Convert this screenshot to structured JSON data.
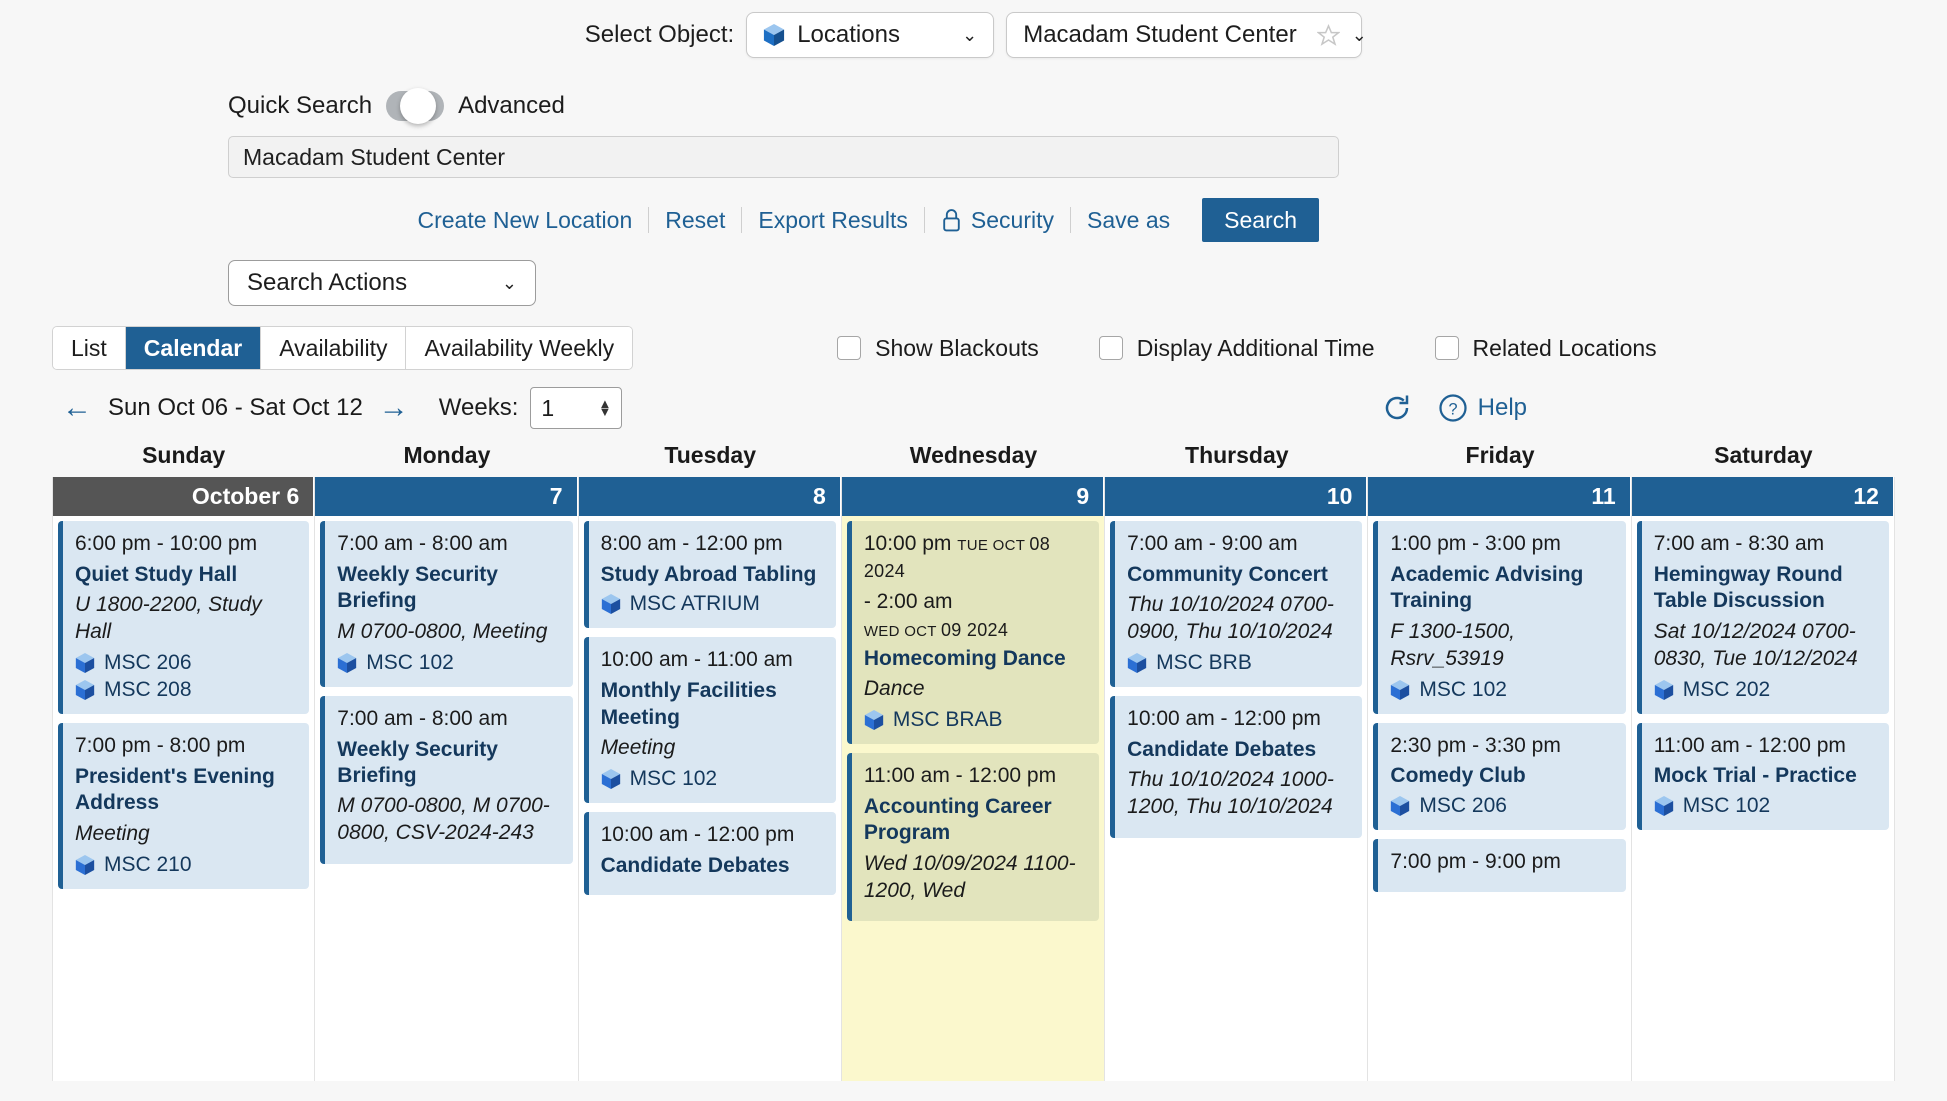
{
  "select_object": {
    "label": "Select Object:",
    "object_value": "Locations",
    "object_icon": "cube-icon",
    "location_value": "Macadam Student Center",
    "favorite_icon": "star-icon",
    "chevron": "⌄"
  },
  "quick_search": {
    "left_label": "Quick Search",
    "right_label": "Advanced",
    "input_value": "Macadam Student Center",
    "toggle_state": "middle"
  },
  "actions": {
    "create": "Create New Location",
    "reset": "Reset",
    "export": "Export Results",
    "security": "Security",
    "security_icon": "lock-icon",
    "save_as": "Save as",
    "search": "Search",
    "search_actions": "Search Actions"
  },
  "tabs": [
    {
      "label": "List",
      "active": false
    },
    {
      "label": "Calendar",
      "active": true
    },
    {
      "label": "Availability",
      "active": false
    },
    {
      "label": "Availability Weekly",
      "active": false
    }
  ],
  "checkboxes": [
    {
      "label": "Show Blackouts",
      "checked": false
    },
    {
      "label": "Display Additional Time",
      "checked": false
    },
    {
      "label": "Related Locations",
      "checked": false
    }
  ],
  "nav": {
    "prev_icon": "arrow-left-icon",
    "next_icon": "arrow-right-icon",
    "range": "Sun Oct 06 - Sat Oct 12",
    "weeks_label": "Weeks:",
    "weeks_value": "1",
    "refresh_icon": "refresh-icon",
    "help_icon": "help-icon",
    "help_label": "Help"
  },
  "colors": {
    "accent": "#1f6094",
    "today_header": "#555555",
    "event_bg": "#dae7f2",
    "event_bg_highlight": "#e2e4bd",
    "day_highlight_bg": "#fbf8cd",
    "title": "#14385c",
    "link": "#1f6094"
  },
  "calendar": {
    "days": [
      {
        "dow": "Sunday",
        "num": "October 6",
        "today": true,
        "highlight": false,
        "events": [
          {
            "time": "6:00 pm - 10:00 pm",
            "title": "Quiet Study Hall",
            "sub": "U 1800-2200, Study Hall",
            "rooms": [
              "MSC 206",
              "MSC 208"
            ]
          },
          {
            "time": "7:00 pm - 8:00 pm",
            "title": "President's Evening Address",
            "sub": "Meeting",
            "rooms": [
              "MSC 210"
            ]
          }
        ]
      },
      {
        "dow": "Monday",
        "num": "7",
        "today": false,
        "highlight": false,
        "events": [
          {
            "time": "7:00 am - 8:00 am",
            "title": "Weekly Security Briefing",
            "sub": "M 0700-0800, Meeting",
            "rooms": [
              "MSC 102"
            ]
          },
          {
            "time": "7:00 am - 8:00 am",
            "title": "Weekly Security Briefing",
            "sub": "M 0700-0800, M 0700-0800, CSV-2024-243",
            "rooms": []
          }
        ]
      },
      {
        "dow": "Tuesday",
        "num": "8",
        "today": false,
        "highlight": false,
        "events": [
          {
            "time": "8:00 am - 12:00 pm",
            "title": "Study Abroad Tabling",
            "sub": "",
            "rooms": [
              "MSC ATRIUM"
            ]
          },
          {
            "time": "10:00 am - 11:00 am",
            "title": "Monthly Facilities Meeting",
            "sub": "Meeting",
            "rooms": [
              "MSC 102"
            ]
          },
          {
            "time": "10:00 am - 12:00 pm",
            "title": "Candidate Debates",
            "sub": "",
            "rooms": []
          }
        ]
      },
      {
        "dow": "Wednesday",
        "num": "9",
        "today": false,
        "highlight": true,
        "events": [
          {
            "time": "10:00 pm",
            "time_stamp": "TUE OCT 08 2024",
            "time2": "- 2:00 am",
            "time2_stamp": "WED OCT 09 2024",
            "title": "Homecoming Dance",
            "sub": "Dance",
            "rooms": [
              "MSC BRAB"
            ]
          },
          {
            "time": "11:00 am - 12:00 pm",
            "title": "Accounting Career Program",
            "sub": "Wed 10/09/2024 1100-1200, Wed",
            "rooms": []
          }
        ]
      },
      {
        "dow": "Thursday",
        "num": "10",
        "today": false,
        "highlight": false,
        "events": [
          {
            "time": "7:00 am - 9:00 am",
            "title": "Community Concert",
            "sub": "Thu 10/10/2024 0700-0900, Thu 10/10/2024",
            "rooms": [
              "MSC BRB"
            ]
          },
          {
            "time": "10:00 am - 12:00 pm",
            "title": "Candidate Debates",
            "sub": "Thu 10/10/2024 1000-1200, Thu 10/10/2024",
            "rooms": []
          }
        ]
      },
      {
        "dow": "Friday",
        "num": "11",
        "today": false,
        "highlight": false,
        "events": [
          {
            "time": "1:00 pm - 3:00 pm",
            "title": "Academic Advising Training",
            "sub": "F 1300-1500, Rsrv_53919",
            "rooms": [
              "MSC 102"
            ]
          },
          {
            "time": "2:30 pm - 3:30 pm",
            "title": "Comedy Club",
            "sub": "",
            "rooms": [
              "MSC 206"
            ]
          },
          {
            "time": "7:00 pm - 9:00 pm",
            "title": "",
            "sub": "",
            "rooms": []
          }
        ]
      },
      {
        "dow": "Saturday",
        "num": "12",
        "today": false,
        "highlight": false,
        "events": [
          {
            "time": "7:00 am - 8:30 am",
            "title": "Hemingway Round Table Discussion",
            "sub": "Sat 10/12/2024 0700-0830, Tue 10/12/2024",
            "rooms": [
              "MSC 202"
            ]
          },
          {
            "time": "11:00 am - 12:00 pm",
            "title": "Mock Trial - Practice",
            "sub": "",
            "rooms": [
              "MSC 102"
            ]
          }
        ]
      }
    ]
  }
}
